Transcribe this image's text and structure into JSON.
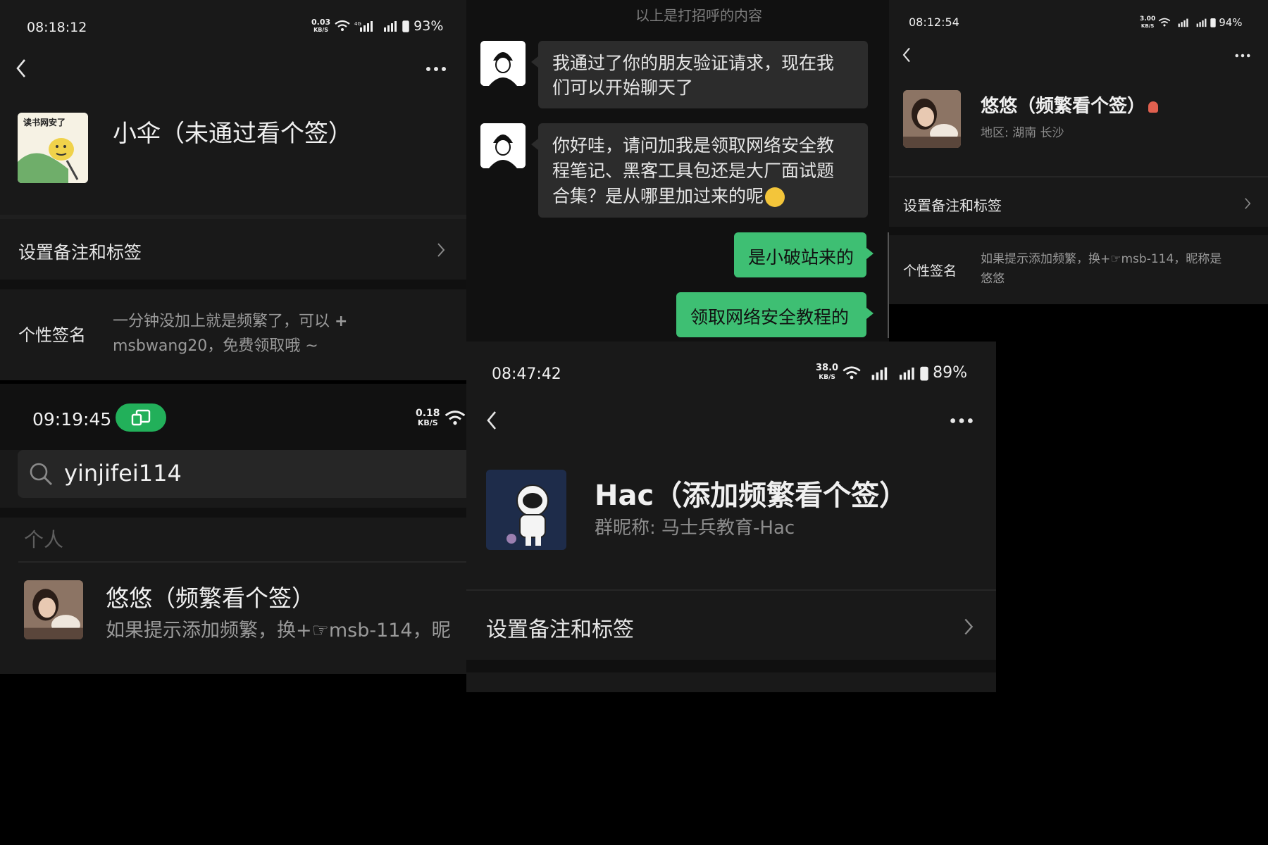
{
  "panel_a": {
    "status": {
      "time": "08:18:12",
      "speed_top": "0.03",
      "speed_unit": "KB/S",
      "battery": "93%"
    },
    "name": "小伞（未通过看个签）",
    "avatar_text": "读书网安了",
    "row_remark": "设置备注和标签",
    "signature_label": "个性签名",
    "signature_line1": "一分钟没加上就是频繁了，可以",
    "signature_line2": "msbwang20，免费领取哦 ~"
  },
  "panel_b": {
    "header_text": "以上是打招呼的内容",
    "messages": [
      {
        "dir": "in",
        "text_line1": "我通过了你的朋友验证请求，现在我",
        "text_line2": "们可以开始聊天了"
      },
      {
        "dir": "in",
        "text_line1": "你好哇，请问加我是领取网络安全教",
        "text_line2": "程笔记、黑客工具包还是大厂面试题",
        "text_line3": "合集？是从哪里加过来的呢"
      },
      {
        "dir": "out",
        "text": "是小破站来的"
      },
      {
        "dir": "out",
        "text": "领取网络安全教程的"
      }
    ]
  },
  "panel_c": {
    "status": {
      "time": "08:12:54",
      "speed_top": "3.00",
      "speed_unit": "KB/S",
      "battery": "94%"
    },
    "name": "悠悠（频繁看个签）",
    "region": "地区: 湖南  长沙",
    "row_remark": "设置备注和标签",
    "signature_label": "个性签名",
    "signature_line1": "如果提示添加频繁，换+☞msb-114，昵称是",
    "signature_line2": "悠悠"
  },
  "panel_d": {
    "status": {
      "time": "09:19:45",
      "speed_top": "0.18",
      "speed_unit": "KB/S"
    },
    "search_value": "yinjifei114",
    "section_label": "个人",
    "result_name": "悠悠（频繁看个签）",
    "result_sub": "如果提示添加频繁，换+☞msb-114，昵"
  },
  "panel_e": {
    "status": {
      "time": "08:47:42",
      "speed_top": "38.0",
      "speed_unit": "KB/S",
      "battery": "89%"
    },
    "name": "Hac（添加频繁看个签）",
    "group_nick": "群昵称: 马士兵教育-Hac",
    "row_remark": "设置备注和标签"
  },
  "colors": {
    "panel_bg": "#191919",
    "bubble_out": "#3ebf73",
    "bubble_in": "#2c2c2c",
    "badge_green": "#22b05a"
  }
}
